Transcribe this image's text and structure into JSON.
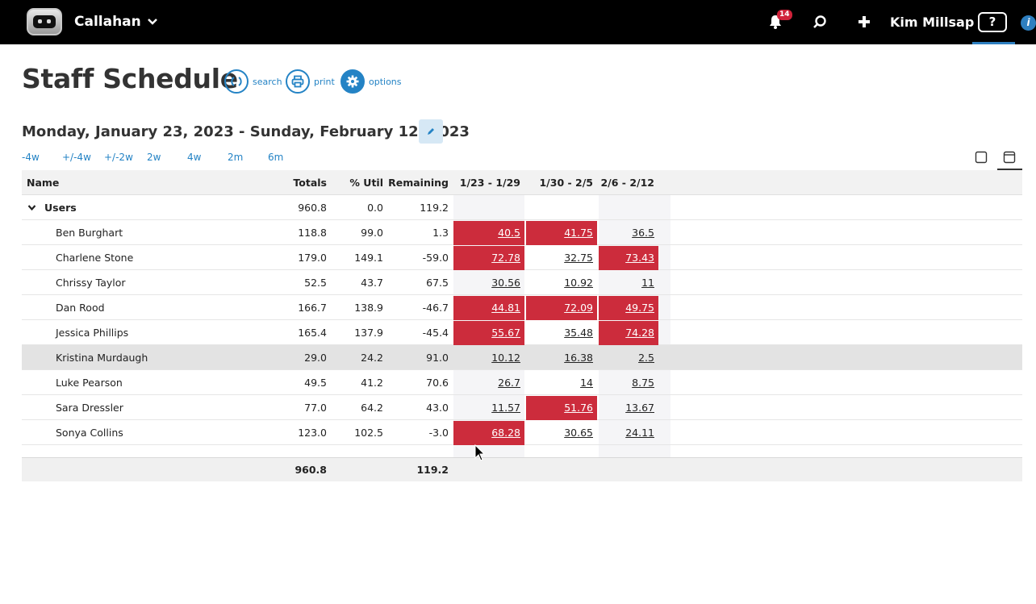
{
  "topbar": {
    "org_name": "Callahan",
    "notification_count": "14",
    "user_name": "Kim Millsap",
    "help_label": "?",
    "info_label": "i"
  },
  "page": {
    "title": "Staff Schedule",
    "actions": {
      "search": "search",
      "print": "print",
      "options": "options"
    },
    "date_range": "Monday, January 23, 2023 - Sunday, February 12, 2023",
    "range_links": [
      "-4w",
      "+/-4w",
      "+/-2w",
      "2w",
      "4w",
      "2m",
      "6m"
    ]
  },
  "table": {
    "headers": {
      "name": "Name",
      "totals": "Totals",
      "util": "% Util",
      "remaining": "Remaining",
      "weeks": [
        "1/23 - 1/29",
        "1/30 - 2/5",
        "2/6 - 2/12"
      ]
    },
    "group": {
      "label": "Users",
      "totals": "960.8",
      "util": "0.0",
      "remaining": "119.2"
    },
    "rows": [
      {
        "name": "Ben Burghart",
        "totals": "118.8",
        "util": "99.0",
        "remaining": "1.3",
        "weeks": [
          "40.5",
          "41.75",
          "36.5"
        ],
        "over": [
          true,
          true,
          false
        ]
      },
      {
        "name": "Charlene Stone",
        "totals": "179.0",
        "util": "149.1",
        "remaining": "-59.0",
        "weeks": [
          "72.78",
          "32.75",
          "73.43"
        ],
        "over": [
          true,
          false,
          true
        ]
      },
      {
        "name": "Chrissy Taylor",
        "totals": "52.5",
        "util": "43.7",
        "remaining": "67.5",
        "weeks": [
          "30.56",
          "10.92",
          "11"
        ],
        "over": [
          false,
          false,
          false
        ]
      },
      {
        "name": "Dan Rood",
        "totals": "166.7",
        "util": "138.9",
        "remaining": "-46.7",
        "weeks": [
          "44.81",
          "72.09",
          "49.75"
        ],
        "over": [
          true,
          true,
          true
        ]
      },
      {
        "name": "Jessica Phillips",
        "totals": "165.4",
        "util": "137.9",
        "remaining": "-45.4",
        "weeks": [
          "55.67",
          "35.48",
          "74.28"
        ],
        "over": [
          true,
          false,
          true
        ]
      },
      {
        "name": "Kristina Murdaugh",
        "totals": "29.0",
        "util": "24.2",
        "remaining": "91.0",
        "weeks": [
          "10.12",
          "16.38",
          "2.5"
        ],
        "over": [
          false,
          false,
          false
        ]
      },
      {
        "name": "Luke Pearson",
        "totals": "49.5",
        "util": "41.2",
        "remaining": "70.6",
        "weeks": [
          "26.7",
          "14",
          "8.75"
        ],
        "over": [
          false,
          false,
          false
        ]
      },
      {
        "name": "Sara Dressler",
        "totals": "77.0",
        "util": "64.2",
        "remaining": "43.0",
        "weeks": [
          "11.57",
          "51.76",
          "13.67"
        ],
        "over": [
          false,
          true,
          false
        ]
      },
      {
        "name": "Sonya Collins",
        "totals": "123.0",
        "util": "102.5",
        "remaining": "-3.0",
        "weeks": [
          "68.28",
          "30.65",
          "24.11"
        ],
        "over": [
          true,
          false,
          false
        ]
      }
    ],
    "footer": {
      "totals": "960.8",
      "remaining": "119.2"
    }
  },
  "colors": {
    "topbar": "#000000",
    "accent": "#2483c5",
    "over_capacity": "#cc2c3c",
    "notification": "#d0223a"
  }
}
